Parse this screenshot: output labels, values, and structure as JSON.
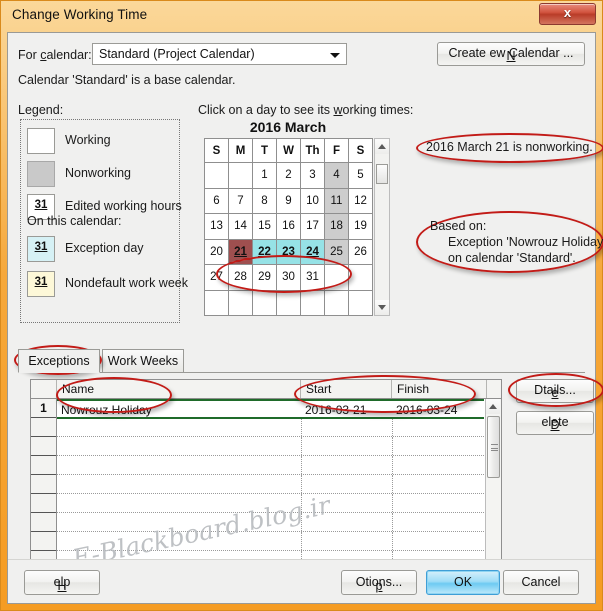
{
  "window": {
    "title": "Change Working Time",
    "close_icon": "close-icon",
    "close_label": "x"
  },
  "form": {
    "for_calendar_label": "For calendar:",
    "calendar_value": "Standard (Project Calendar)",
    "calendar_dropdown_icon": "chevron-down-icon",
    "create_new_calendar_label": "Create New Calendar ...",
    "base_calendar_note": "Calendar 'Standard' is a base calendar."
  },
  "legend": {
    "title": "Legend:",
    "on_this_calendar_label": "On this calendar:",
    "items": [
      {
        "label": "Working",
        "swatch": "working",
        "day_number": ""
      },
      {
        "label": "Nonworking",
        "swatch": "nonwork",
        "day_number": ""
      },
      {
        "label": "Edited working hours",
        "swatch": "edited",
        "day_number": "31"
      },
      {
        "label": "Exception day",
        "swatch": "exception",
        "day_number": "31"
      },
      {
        "label": "Nondefault work week",
        "swatch": "nondef",
        "day_number": "31"
      }
    ]
  },
  "calendar": {
    "hint": "Click on a day to see its working times:",
    "month_title": "2016 March",
    "weekday_headers": [
      "S",
      "M",
      "T",
      "W",
      "Th",
      "F",
      "S"
    ],
    "weeks": [
      [
        {
          "d": "",
          "state": "blank"
        },
        {
          "d": "",
          "state": "blank"
        },
        {
          "d": "1",
          "state": "working"
        },
        {
          "d": "2",
          "state": "working"
        },
        {
          "d": "3",
          "state": "working"
        },
        {
          "d": "4",
          "state": "nonworking"
        },
        {
          "d": "5",
          "state": "working"
        }
      ],
      [
        {
          "d": "6",
          "state": "working"
        },
        {
          "d": "7",
          "state": "working"
        },
        {
          "d": "8",
          "state": "working"
        },
        {
          "d": "9",
          "state": "working"
        },
        {
          "d": "10",
          "state": "working"
        },
        {
          "d": "11",
          "state": "nonworking"
        },
        {
          "d": "12",
          "state": "working"
        }
      ],
      [
        {
          "d": "13",
          "state": "working"
        },
        {
          "d": "14",
          "state": "working"
        },
        {
          "d": "15",
          "state": "working"
        },
        {
          "d": "16",
          "state": "working"
        },
        {
          "d": "17",
          "state": "working"
        },
        {
          "d": "18",
          "state": "nonworking"
        },
        {
          "d": "19",
          "state": "working"
        }
      ],
      [
        {
          "d": "20",
          "state": "working"
        },
        {
          "d": "21",
          "state": "selected"
        },
        {
          "d": "22",
          "state": "exception"
        },
        {
          "d": "23",
          "state": "exception"
        },
        {
          "d": "24",
          "state": "exception"
        },
        {
          "d": "25",
          "state": "nonworking"
        },
        {
          "d": "26",
          "state": "working"
        }
      ],
      [
        {
          "d": "27",
          "state": "working"
        },
        {
          "d": "28",
          "state": "working"
        },
        {
          "d": "29",
          "state": "working"
        },
        {
          "d": "30",
          "state": "working"
        },
        {
          "d": "31",
          "state": "working"
        },
        {
          "d": "",
          "state": "blank"
        },
        {
          "d": "",
          "state": "blank"
        }
      ],
      [
        {
          "d": "",
          "state": "blank"
        },
        {
          "d": "",
          "state": "blank"
        },
        {
          "d": "",
          "state": "blank"
        },
        {
          "d": "",
          "state": "blank"
        },
        {
          "d": "",
          "state": "blank"
        },
        {
          "d": "",
          "state": "blank"
        },
        {
          "d": "",
          "state": "blank"
        }
      ]
    ]
  },
  "annotations": {
    "note1": "2016 March 21 is nonworking.",
    "note2_line1": "Based on:",
    "note2_line2": "Exception 'Nowrouz Holiday'",
    "note2_line3": "on calendar 'Standard'."
  },
  "tabs": [
    {
      "label": "Exceptions",
      "active": true
    },
    {
      "label": "Work Weeks",
      "active": false
    }
  ],
  "table": {
    "headers": {
      "rownum": "",
      "name": "Name",
      "start": "Start",
      "finish": "Finish"
    },
    "rows": [
      {
        "num": "1",
        "name": "Nowrouz Holiday",
        "start": "2016-03-21",
        "finish": "2016-03-24"
      }
    ],
    "empty_row_numbers": [
      "",
      "",
      "",
      "",
      "",
      "",
      "",
      "",
      ""
    ]
  },
  "side_buttons": {
    "details_label": "Details...",
    "delete_label": "Delete"
  },
  "bottom_buttons": {
    "help_label": "Help",
    "options_label": "Options...",
    "ok_label": "OK",
    "cancel_label": "Cancel"
  },
  "watermark": {
    "text": "E-Blackboard.blog.ir"
  },
  "colors": {
    "frame": "#f59c23",
    "callout": "#c21b17",
    "exception_day": "#6fd6dd",
    "selected_day": "#8b2a2a",
    "nonworking_day": "#cdcdcd",
    "selected_row_border": "#1f6b2a",
    "default_button": "#6ecbf2"
  }
}
